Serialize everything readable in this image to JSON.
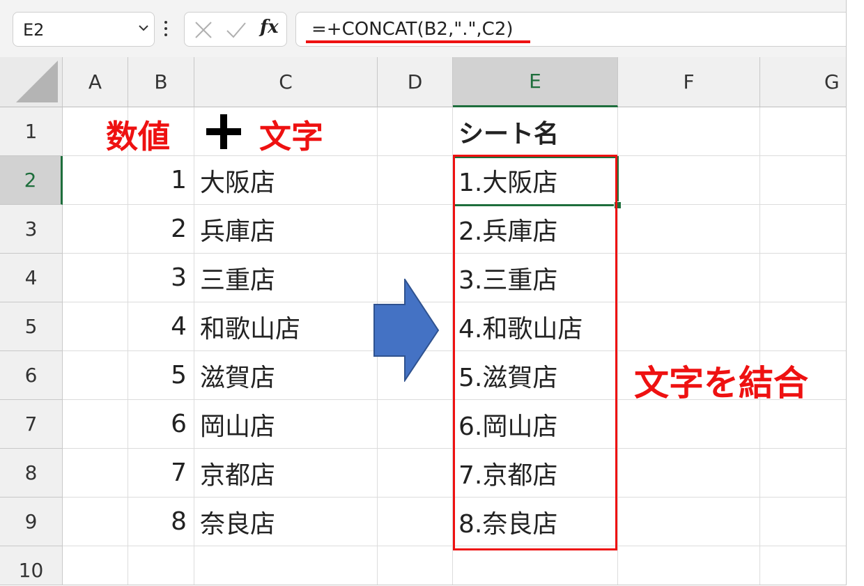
{
  "name_box": {
    "value": "E2"
  },
  "formula_bar": {
    "formula": "=+CONCAT(B2,\".\",C2)"
  },
  "columns": [
    "A",
    "B",
    "C",
    "D",
    "E",
    "F",
    "G"
  ],
  "selected_column": "E",
  "rows": [
    "1",
    "2",
    "3",
    "4",
    "5",
    "6",
    "7",
    "8",
    "9",
    "10"
  ],
  "selected_row": "2",
  "header_cell": {
    "ref": "E1",
    "text": "シート名"
  },
  "data_rows": [
    {
      "b": "1",
      "c": "大阪店",
      "e": "1.大阪店"
    },
    {
      "b": "2",
      "c": "兵庫店",
      "e": "2.兵庫店"
    },
    {
      "b": "3",
      "c": "三重店",
      "e": "3.三重店"
    },
    {
      "b": "4",
      "c": "和歌山店",
      "e": "4.和歌山店"
    },
    {
      "b": "5",
      "c": "滋賀店",
      "e": "5.滋賀店"
    },
    {
      "b": "6",
      "c": "岡山店",
      "e": "6.岡山店"
    },
    {
      "b": "7",
      "c": "京都店",
      "e": "7.京都店"
    },
    {
      "b": "8",
      "c": "奈良店",
      "e": "8.奈良店"
    }
  ],
  "annotations": {
    "number_label": "数値",
    "text_label": "文字",
    "combine_label": "文字を結合"
  },
  "colors": {
    "accent_red": "#ee1111",
    "selection_green": "#1e6e3c",
    "arrow_blue": "#4472c4"
  }
}
